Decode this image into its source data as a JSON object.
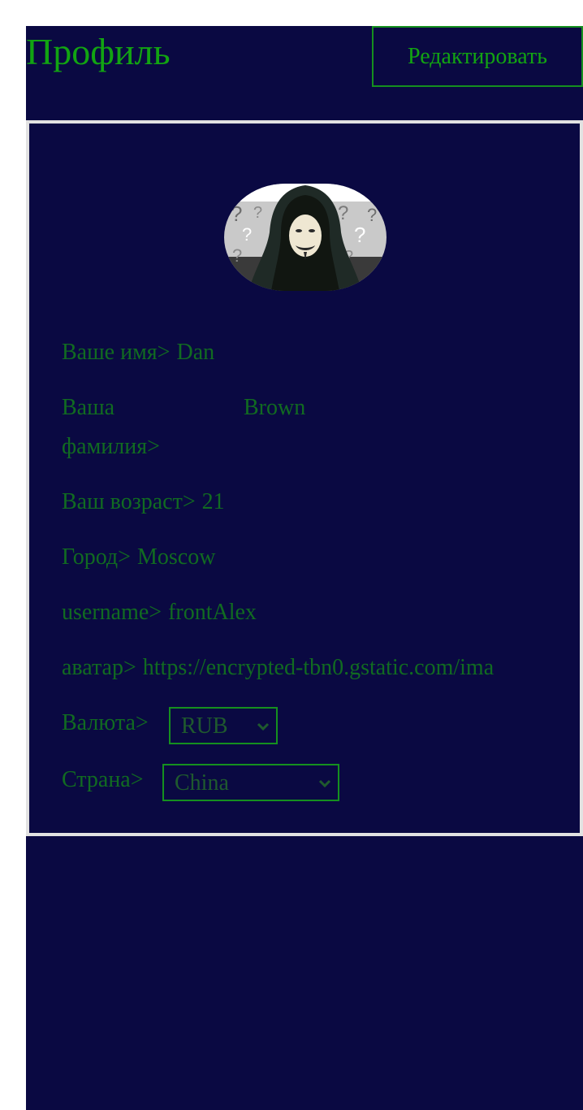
{
  "header": {
    "title": "Профиль",
    "edit_label": "Редактировать"
  },
  "profile": {
    "name_label": "Ваше имя>",
    "name_value": "Dan",
    "surname_label": "Ваша фамилия>",
    "surname_value": "Brown",
    "age_label": "Ваш возраст>",
    "age_value": "21",
    "city_label": "Город>",
    "city_value": "Moscow",
    "username_label": "username>",
    "username_value": "frontAlex",
    "avatar_label": "аватар>",
    "avatar_value": "https://encrypted-tbn0.gstatic.com/ima",
    "currency_label": "Валюта>",
    "currency_value": "RUB",
    "country_label": "Страна>",
    "country_value": "China"
  },
  "colors": {
    "background": "#0a0942",
    "accent_green": "#12a412",
    "text_green": "#116b21",
    "border": "#e2e2e2"
  },
  "icons": {
    "avatar": "anonymous-hooded-figure",
    "select_chevron": "chevron-down-icon"
  }
}
